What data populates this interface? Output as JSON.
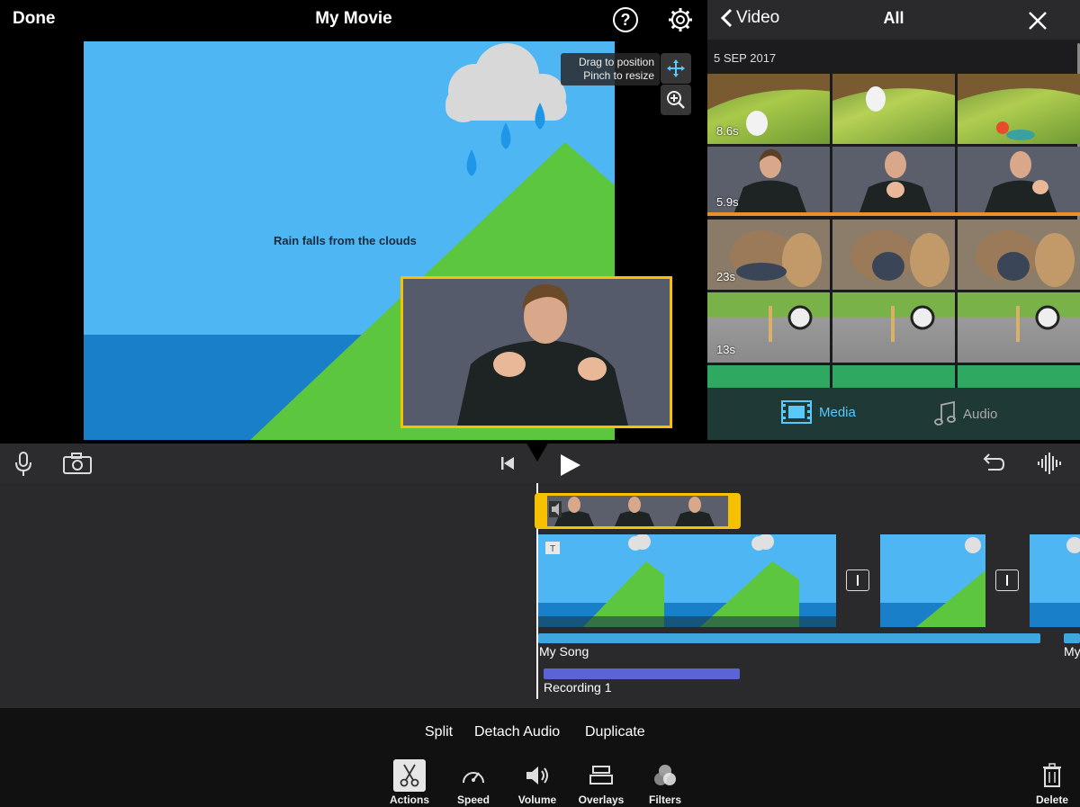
{
  "header": {
    "done_label": "Done",
    "title": "My Movie"
  },
  "preview": {
    "caption": "Rain falls from the clouds",
    "hint_line1": "Drag to position",
    "hint_line2": "Pinch to resize"
  },
  "browser": {
    "back_label": "Video",
    "title": "All",
    "date": "5 SEP 2017",
    "durations": [
      "8.6s",
      "5.9s",
      "23s",
      "13s"
    ],
    "tabs": {
      "media": "Media",
      "audio": "Audio"
    },
    "accent": "#5ac8fa"
  },
  "timeline": {
    "song_label": "My Song",
    "song_label_2": "My",
    "recording_label": "Recording 1"
  },
  "actions": {
    "split": "Split",
    "detach": "Detach Audio",
    "duplicate": "Duplicate"
  },
  "tools": {
    "actions": "Actions",
    "speed": "Speed",
    "volume": "Volume",
    "overlays": "Overlays",
    "filters": "Filters",
    "delete": "Delete"
  },
  "colors": {
    "selection": "#f5c100",
    "song": "#3fa7df",
    "recording": "#5b63d6",
    "sky": "#4fb6f4",
    "hill": "#5cc63f",
    "sea": "#1a7fc9"
  }
}
